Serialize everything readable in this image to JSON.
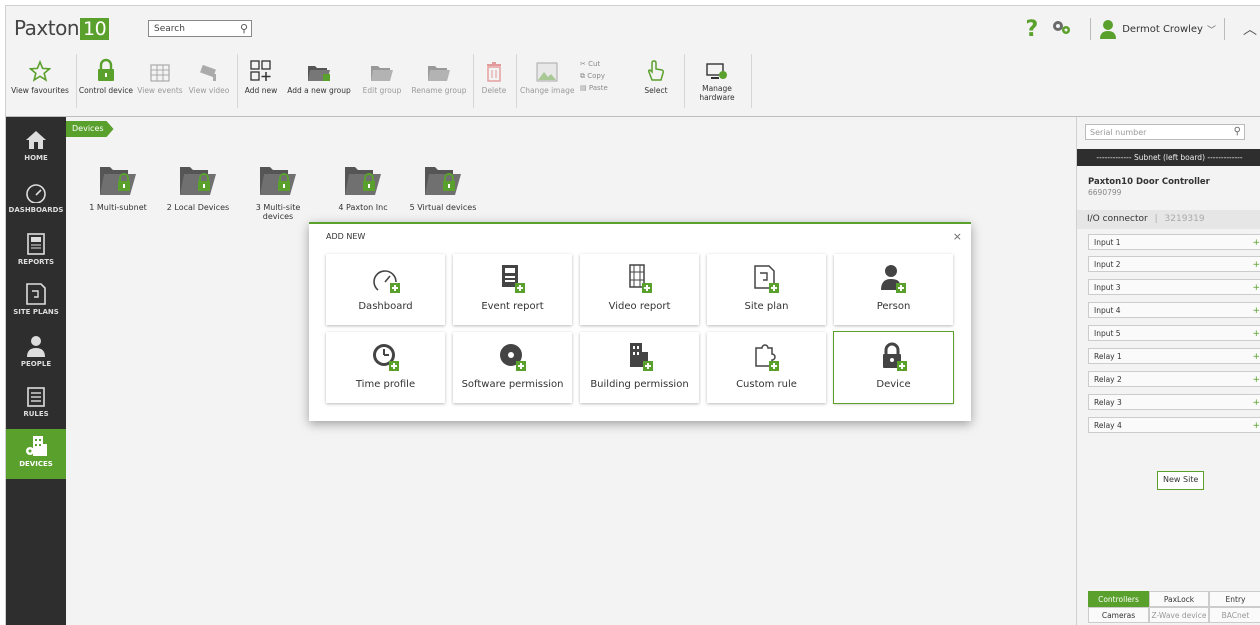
{
  "app": {
    "logo_text": "Paxton",
    "logo_version": "10"
  },
  "header": {
    "search_label": "Search",
    "help_glyph": "?",
    "user_name": "Dermot Crowley",
    "brand_color": "#5aa02c"
  },
  "toolbar": {
    "view_favourites": "View favourites",
    "control_device": "Control device",
    "view_events": "View events",
    "view_video": "View video",
    "add_new": "Add new",
    "add_new_group": "Add a new group",
    "edit_group": "Edit group",
    "rename_group": "Rename group",
    "delete": "Delete",
    "change_image": "Change image",
    "cut": "Cut",
    "copy": "Copy",
    "paste": "Paste",
    "select": "Select",
    "manage_hardware_1": "Manage",
    "manage_hardware_2": "hardware"
  },
  "nav": {
    "home": "HOME",
    "dashboards": "DASHBOARDS",
    "reports": "REPORTS",
    "site_plans": "SITE PLANS",
    "people": "PEOPLE",
    "rules": "RULES",
    "devices": "DEVICES"
  },
  "breadcrumb": {
    "devices": "Devices"
  },
  "folders": [
    {
      "label": "1 Multi-subnet"
    },
    {
      "label": "2 Local Devices"
    },
    {
      "label": "3 Multi-site devices"
    },
    {
      "label": "4 Paxton Inc"
    },
    {
      "label": "5 Virtual devices"
    }
  ],
  "modal": {
    "title": "ADD NEW",
    "close": "×",
    "tiles": [
      {
        "label": "Dashboard",
        "icon": "dashboard-add-icon"
      },
      {
        "label": "Event report",
        "icon": "event-report-add-icon"
      },
      {
        "label": "Video report",
        "icon": "video-report-add-icon"
      },
      {
        "label": "Site plan",
        "icon": "site-plan-add-icon"
      },
      {
        "label": "Person",
        "icon": "person-add-icon"
      },
      {
        "label": "Time profile",
        "icon": "time-profile-add-icon"
      },
      {
        "label": "Software permission",
        "icon": "software-permission-add-icon"
      },
      {
        "label": "Building permission",
        "icon": "building-permission-add-icon"
      },
      {
        "label": "Custom rule",
        "icon": "custom-rule-add-icon"
      },
      {
        "label": "Device",
        "icon": "device-add-icon"
      }
    ]
  },
  "panel": {
    "serial_placeholder": "Serial number",
    "subnet": "Subnet (left board)",
    "controller_name": "Paxton10 Door Controller",
    "controller_serial": "6690799",
    "io_label": "I/O connector",
    "io_serial": "3219319",
    "rows": [
      "Input 1",
      "Input 2",
      "Input 3",
      "Input 4",
      "Input 5",
      "Relay 1",
      "Relay 2",
      "Relay 3",
      "Relay 4"
    ],
    "new_site": "New Site",
    "tabs": [
      "Controllers",
      "PaxLock",
      "Entry",
      "Cameras",
      "Z-Wave device",
      "BACnet"
    ]
  }
}
